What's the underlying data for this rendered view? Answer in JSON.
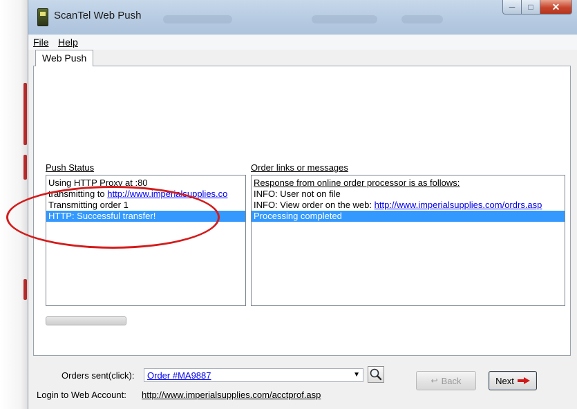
{
  "window": {
    "title": "ScanTel Web Push"
  },
  "menu": {
    "items": [
      {
        "label": "File"
      },
      {
        "label": "Help"
      }
    ]
  },
  "tab": {
    "label": "Web Push"
  },
  "push_status": {
    "label": "Push Status",
    "rows": [
      {
        "text": "Using HTTP Proxy at :80"
      },
      {
        "prefix": "transmitting to ",
        "link": "http://www.imperialsupplies.co"
      },
      {
        "text": "Transmitting order 1"
      },
      {
        "text": "HTTP: Successful transfer!",
        "selected": true
      }
    ]
  },
  "order_messages": {
    "label": "Order links or messages",
    "rows": [
      {
        "text": "Response from online order processor is as follows:"
      },
      {
        "text": "INFO: User not on file"
      },
      {
        "prefix": "INFO: View order on the web: ",
        "link": "http://www.imperialsupplies.com/ordrs.asp"
      },
      {
        "text": "Processing completed",
        "selected": true
      }
    ]
  },
  "progress": {
    "fraction": 1.0
  },
  "orders_sent": {
    "label": "Orders sent(click):",
    "value": "Order #MA9887"
  },
  "login": {
    "label": "Login to Web Account:",
    "link": "http://www.imperialsupplies.com/acctprof.asp"
  },
  "buttons": {
    "back": "Back",
    "next": "Next"
  },
  "colors": {
    "selection": "#3399ff",
    "annotation": "#d41c1c",
    "link": "#0000ee"
  }
}
